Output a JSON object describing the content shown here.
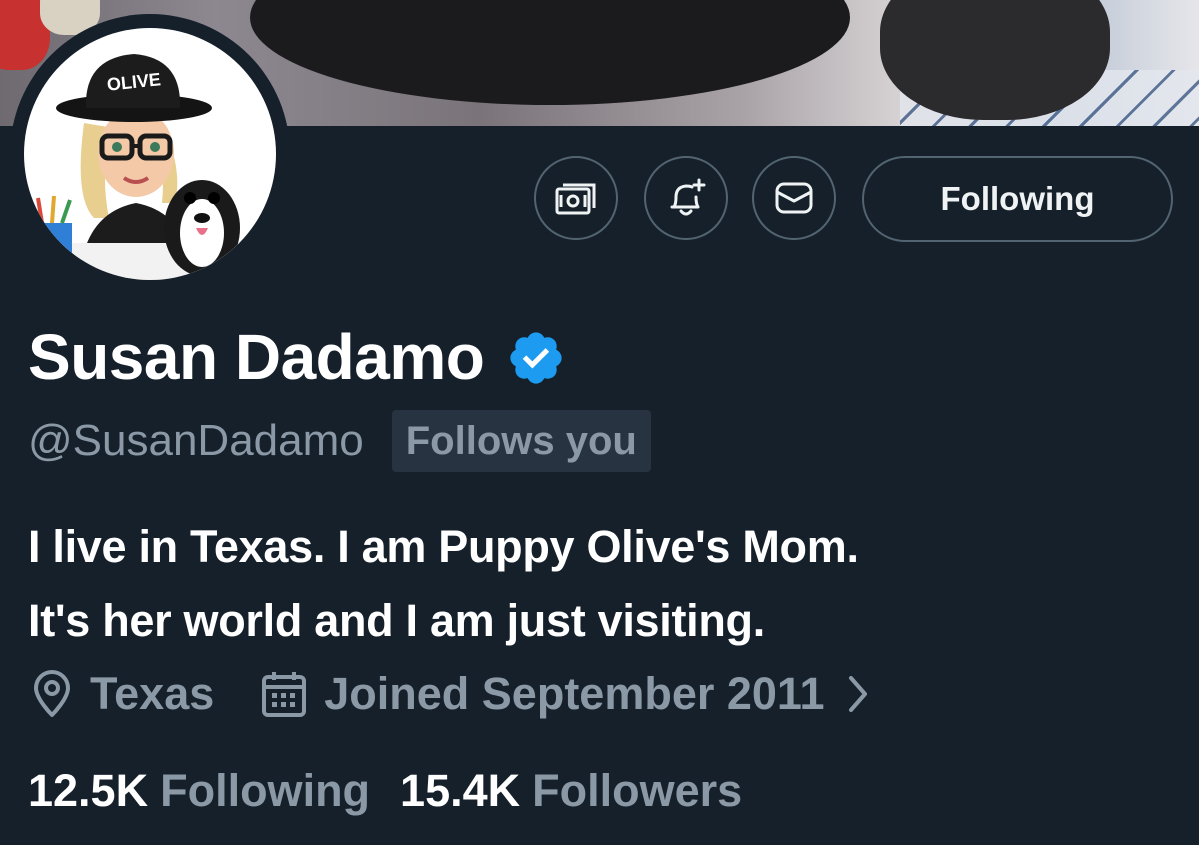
{
  "profile": {
    "name": "Susan Dadamo",
    "handle": "@SusanDadamo",
    "follows_you": "Follows you",
    "bio_line1": "I live in Texas. I am Puppy Olive's Mom.",
    "bio_line2": "It's her world and I am just visiting.",
    "location": "Texas",
    "joined": "Joined September 2011",
    "following_count": "12.5K",
    "following_label": "Following",
    "followers_count": "15.4K",
    "followers_label": "Followers",
    "avatar_hat_text": "OLIVE"
  },
  "actions": {
    "follow_button": "Following",
    "icons": [
      "subscription-money-icon",
      "notification-bell-plus-icon",
      "message-envelope-icon"
    ]
  },
  "colors": {
    "background": "#15202b",
    "verified": "#1d9bf0",
    "secondary_text": "#8b98a5",
    "border": "#536471"
  }
}
